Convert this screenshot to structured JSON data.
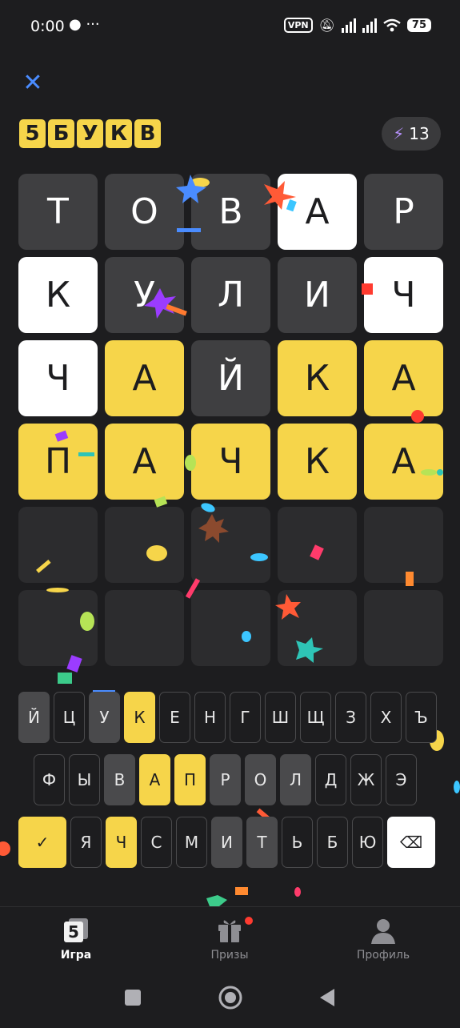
{
  "status": {
    "time": "0:00",
    "more": "···",
    "vpn": "VPN",
    "battery": "75"
  },
  "header": {
    "logo_letters": [
      "5",
      "Б",
      "У",
      "К",
      "В"
    ],
    "energy_count": "13"
  },
  "board": [
    [
      {
        "l": "Т",
        "s": "gray"
      },
      {
        "l": "О",
        "s": "gray"
      },
      {
        "l": "В",
        "s": "gray"
      },
      {
        "l": "А",
        "s": "white"
      },
      {
        "l": "Р",
        "s": "gray"
      }
    ],
    [
      {
        "l": "К",
        "s": "white"
      },
      {
        "l": "У",
        "s": "gray"
      },
      {
        "l": "Л",
        "s": "gray"
      },
      {
        "l": "И",
        "s": "gray"
      },
      {
        "l": "Ч",
        "s": "white"
      }
    ],
    [
      {
        "l": "Ч",
        "s": "white"
      },
      {
        "l": "А",
        "s": "yellow"
      },
      {
        "l": "Й",
        "s": "gray"
      },
      {
        "l": "К",
        "s": "yellow"
      },
      {
        "l": "А",
        "s": "yellow"
      }
    ],
    [
      {
        "l": "П",
        "s": "yellow"
      },
      {
        "l": "А",
        "s": "yellow"
      },
      {
        "l": "Ч",
        "s": "yellow"
      },
      {
        "l": "К",
        "s": "yellow"
      },
      {
        "l": "А",
        "s": "yellow"
      }
    ],
    [
      {
        "l": "",
        "s": "empty"
      },
      {
        "l": "",
        "s": "empty"
      },
      {
        "l": "",
        "s": "empty"
      },
      {
        "l": "",
        "s": "empty"
      },
      {
        "l": "",
        "s": "empty"
      }
    ],
    [
      {
        "l": "",
        "s": "empty"
      },
      {
        "l": "",
        "s": "empty"
      },
      {
        "l": "",
        "s": "empty"
      },
      {
        "l": "",
        "s": "empty"
      },
      {
        "l": "",
        "s": "empty"
      }
    ]
  ],
  "keyboard": {
    "row1": [
      {
        "k": "Й",
        "s": "used"
      },
      {
        "k": "Ц",
        "s": ""
      },
      {
        "k": "У",
        "s": "used"
      },
      {
        "k": "К",
        "s": "yellow"
      },
      {
        "k": "Е",
        "s": ""
      },
      {
        "k": "Н",
        "s": ""
      },
      {
        "k": "Г",
        "s": ""
      },
      {
        "k": "Ш",
        "s": ""
      },
      {
        "k": "Щ",
        "s": ""
      },
      {
        "k": "З",
        "s": ""
      },
      {
        "k": "Х",
        "s": ""
      },
      {
        "k": "Ъ",
        "s": ""
      }
    ],
    "row2": [
      {
        "k": "Ф",
        "s": ""
      },
      {
        "k": "Ы",
        "s": ""
      },
      {
        "k": "В",
        "s": "used"
      },
      {
        "k": "А",
        "s": "yellow"
      },
      {
        "k": "П",
        "s": "yellow"
      },
      {
        "k": "Р",
        "s": "used"
      },
      {
        "k": "О",
        "s": "used"
      },
      {
        "k": "Л",
        "s": "used"
      },
      {
        "k": "Д",
        "s": ""
      },
      {
        "k": "Ж",
        "s": ""
      },
      {
        "k": "Э",
        "s": ""
      }
    ],
    "row3": [
      {
        "k": "✓",
        "s": "yellow big"
      },
      {
        "k": "Я",
        "s": ""
      },
      {
        "k": "Ч",
        "s": "yellow"
      },
      {
        "k": "С",
        "s": ""
      },
      {
        "k": "М",
        "s": ""
      },
      {
        "k": "И",
        "s": "used"
      },
      {
        "k": "Т",
        "s": "used"
      },
      {
        "k": "Ь",
        "s": ""
      },
      {
        "k": "Б",
        "s": ""
      },
      {
        "k": "Ю",
        "s": ""
      },
      {
        "k": "⌫",
        "s": "white big"
      }
    ]
  },
  "tabs": [
    {
      "label": "Игра",
      "icon": "game-icon",
      "active": true
    },
    {
      "label": "Призы",
      "icon": "gift-icon",
      "active": false,
      "badge": true
    },
    {
      "label": "Профиль",
      "icon": "profile-icon",
      "active": false
    }
  ],
  "colors": {
    "yellow": "#f6d54a",
    "gray_tile": "#3f3f41",
    "empty_tile": "#2c2c2e",
    "accent_blue": "#4a8cff",
    "badge_red": "#ff3b30"
  }
}
